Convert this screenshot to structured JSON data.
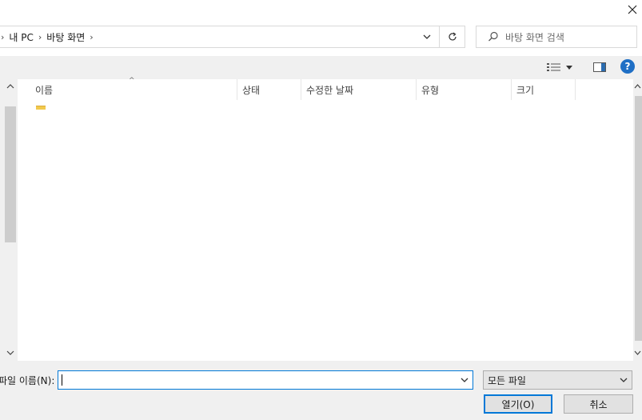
{
  "window": {
    "close_glyph": "✕"
  },
  "address_bar": {
    "crumbs": [
      {
        "label": "내 PC"
      },
      {
        "label": "바탕 화면"
      }
    ],
    "leading_sep": "›",
    "sep": "›",
    "dropdown_icon": "chevron-down-icon",
    "refresh_icon": "refresh-icon"
  },
  "search": {
    "placeholder": "바탕 화면 검색",
    "icon": "search-icon"
  },
  "toolbar": {
    "view_icon": "view-details-icon",
    "pane_icon": "preview-pane-icon",
    "help_label": "?"
  },
  "file_list": {
    "columns": [
      "이름",
      "상태",
      "수정한 날짜",
      "유형",
      "크기"
    ],
    "sort_arrow": "^",
    "rows": []
  },
  "bottom": {
    "file_name_label": "파일 이름(N):",
    "file_name_value": "",
    "file_type_value": "모든 파일",
    "open_label": "열기(O)",
    "cancel_label": "취소"
  },
  "colors": {
    "accent": "#0078d7",
    "toolbar_bg": "#f0f0f0",
    "help_blue": "#1f6fc5"
  }
}
